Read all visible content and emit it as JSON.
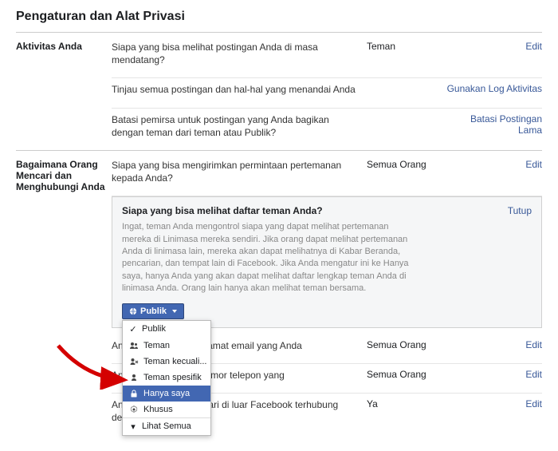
{
  "page_title": "Pengaturan dan Alat Privasi",
  "sections": {
    "activity": {
      "label": "Aktivitas Anda",
      "rows": [
        {
          "desc": "Siapa yang bisa melihat postingan Anda di masa mendatang?",
          "val": "Teman",
          "act": "Edit"
        },
        {
          "desc": "Tinjau semua postingan dan hal-hal yang menandai Anda",
          "val": "",
          "act": "Gunakan Log Aktivitas"
        },
        {
          "desc": "Batasi pemirsa untuk postingan yang Anda bagikan dengan teman dari teman atau Publik?",
          "val": "",
          "act": "Batasi Postingan Lama"
        }
      ]
    },
    "contact": {
      "label": "Bagaimana Orang Mencari dan Menghubungi Anda",
      "rows": {
        "friend_req": {
          "desc": "Siapa yang bisa mengirimkan permintaan pertemanan kepada Anda?",
          "val": "Semua Orang",
          "act": "Edit"
        },
        "expanded": {
          "q": "Siapa yang bisa melihat daftar teman Anda?",
          "close": "Tutup",
          "help": "Ingat, teman Anda mengontrol siapa yang dapat melihat pertemanan mereka di Linimasa mereka sendiri. Jika orang dapat melihat pertemanan Anda di linimasa lain, mereka akan dapat melihatnya di Kabar Beranda, pencarian, dan tempat lain di Facebook. Jika Anda mengatur ini ke Hanya saya, hanya Anda yang akan dapat melihat daftar lengkap teman Anda di linimasa Anda. Orang lain hanya akan melihat teman bersama.",
          "button": "Publik",
          "options": {
            "public": "Publik",
            "friends": "Teman",
            "friends_except": "Teman kecuali...",
            "specific": "Teman spesifik",
            "only_me": "Hanya saya",
            "custom": "Khusus",
            "see_all": "Lihat Semua"
          }
        },
        "email": {
          "desc": "Anda menggunakan alamat email yang Anda",
          "val": "Semua Orang",
          "act": "Edit"
        },
        "phone": {
          "desc": "Anda menggunakan nomor telepon yang",
          "val": "Semua Orang",
          "act": "Edit"
        },
        "search": {
          "desc": "Anda ingin mesin pencari di luar Facebook terhubung dengan profil Anda?",
          "val": "Ya",
          "act": "Edit"
        }
      }
    }
  }
}
